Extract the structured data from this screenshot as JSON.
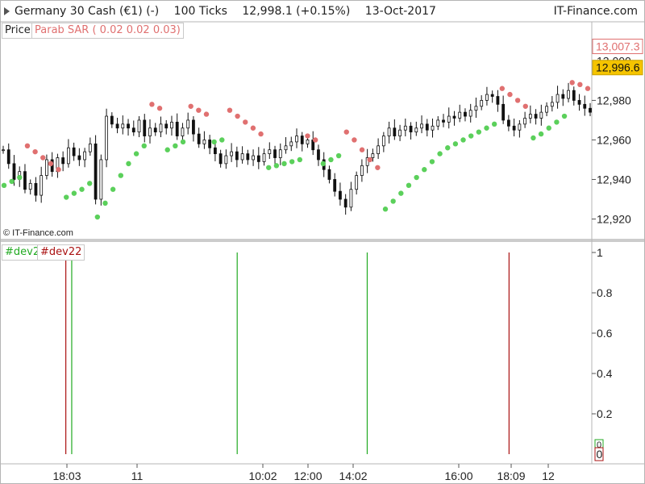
{
  "title_bar": {
    "instrument": "Germany 30 Cash (€1) (-)",
    "timeframe": "100 Ticks",
    "last_price": "12,998.1 (+0.15%)",
    "date": "13-Oct-2017",
    "brand": "IT-Finance.com"
  },
  "price_panel": {
    "legend_price": "Price",
    "legend_indicator": "Parab SAR ( 0.02 0.02 0.03)",
    "watermark": "© IT-Finance.com",
    "sar_label": "13,007.3",
    "price_label": "12,996.6",
    "hidden_tick": "13,000"
  },
  "indicator_panel": {
    "legend_dev2": "#dev2",
    "legend_dev22": "#dev22"
  },
  "colors": {
    "sar_above": "#e07070",
    "sar_below": "#5bd05b",
    "dev2": "#22aa22",
    "dev22": "#aa1111",
    "price_label_bg": "#f5c400"
  },
  "chart_data": [
    {
      "type": "line",
      "title": "Germany 30 Cash (€1) (-)",
      "ylim": [
        12910,
        13012
      ],
      "y_ticks": [
        "12,920",
        "12,940",
        "12,960",
        "12,980"
      ],
      "x_tick_labels": [
        "18:03",
        "11",
        "10:02",
        "12:00",
        "14:02",
        "16:00",
        "18:09",
        "12"
      ],
      "series": [
        {
          "name": "Price",
          "type": "candlestick",
          "values": [
            12955,
            12948,
            12940,
            12944,
            12935,
            12938,
            12932,
            12942,
            12950,
            12944,
            12951,
            12948,
            12956,
            12952,
            12950,
            12954,
            12958,
            12930,
            12950,
            12972,
            12968,
            12966,
            12968,
            12966,
            12964,
            12970,
            12962,
            12966,
            12964,
            12968,
            12966,
            12969,
            12962,
            12966,
            12970,
            12963,
            12958,
            12960,
            12956,
            12953,
            12948,
            12952,
            12954,
            12950,
            12953,
            12950,
            12952,
            12949,
            12953,
            12955,
            12951,
            12955,
            12957,
            12959,
            12962,
            12958,
            12960,
            12955,
            12950,
            12945,
            12940,
            12934,
            12930,
            12926,
            12935,
            12942,
            12947,
            12951,
            12953,
            12957,
            12962,
            12966,
            12962,
            12965,
            12967,
            12964,
            12966,
            12968,
            12965,
            12967,
            12970,
            12969,
            12972,
            12971,
            12974,
            12972,
            12975,
            12977,
            12980,
            12983,
            12982,
            12978,
            12970,
            12967,
            12965,
            12968,
            12971,
            12973,
            12971,
            12974,
            12977,
            12979,
            12983,
            12981,
            12985,
            12980,
            12978,
            12976,
            12974
          ]
        },
        {
          "name": "Parab SAR ( 0.02 0.02 0.03)",
          "type": "scatter",
          "points": [
            {
              "x": 0,
              "y": 12937,
              "side": "below"
            },
            {
              "x": 1,
              "y": 12939,
              "side": "below"
            },
            {
              "x": 2,
              "y": 12941,
              "side": "below"
            },
            {
              "x": 3,
              "y": 12957,
              "side": "above"
            },
            {
              "x": 4,
              "y": 12954,
              "side": "above"
            },
            {
              "x": 5,
              "y": 12951,
              "side": "above"
            },
            {
              "x": 6,
              "y": 12948,
              "side": "above"
            },
            {
              "x": 7,
              "y": 12945,
              "side": "above"
            },
            {
              "x": 8,
              "y": 12931,
              "side": "below"
            },
            {
              "x": 9,
              "y": 12933,
              "side": "below"
            },
            {
              "x": 10,
              "y": 12935,
              "side": "below"
            },
            {
              "x": 11,
              "y": 12938,
              "side": "below"
            },
            {
              "x": 12,
              "y": 12921,
              "side": "below"
            },
            {
              "x": 13,
              "y": 12928,
              "side": "below"
            },
            {
              "x": 14,
              "y": 12935,
              "side": "below"
            },
            {
              "x": 15,
              "y": 12942,
              "side": "below"
            },
            {
              "x": 16,
              "y": 12948,
              "side": "below"
            },
            {
              "x": 17,
              "y": 12953,
              "side": "below"
            },
            {
              "x": 18,
              "y": 12957,
              "side": "below"
            },
            {
              "x": 19,
              "y": 12978,
              "side": "above"
            },
            {
              "x": 20,
              "y": 12976,
              "side": "above"
            },
            {
              "x": 21,
              "y": 12955,
              "side": "below"
            },
            {
              "x": 22,
              "y": 12957,
              "side": "below"
            },
            {
              "x": 23,
              "y": 12959,
              "side": "below"
            },
            {
              "x": 24,
              "y": 12977,
              "side": "above"
            },
            {
              "x": 25,
              "y": 12975,
              "side": "above"
            },
            {
              "x": 26,
              "y": 12973,
              "side": "above"
            },
            {
              "x": 27,
              "y": 12959,
              "side": "below"
            },
            {
              "x": 28,
              "y": 12960,
              "side": "below"
            },
            {
              "x": 29,
              "y": 12975,
              "side": "above"
            },
            {
              "x": 30,
              "y": 12972,
              "side": "above"
            },
            {
              "x": 31,
              "y": 12969,
              "side": "above"
            },
            {
              "x": 32,
              "y": 12966,
              "side": "above"
            },
            {
              "x": 33,
              "y": 12963,
              "side": "above"
            },
            {
              "x": 34,
              "y": 12946,
              "side": "below"
            },
            {
              "x": 35,
              "y": 12947,
              "side": "below"
            },
            {
              "x": 36,
              "y": 12948,
              "side": "below"
            },
            {
              "x": 37,
              "y": 12949,
              "side": "below"
            },
            {
              "x": 38,
              "y": 12950,
              "side": "below"
            },
            {
              "x": 39,
              "y": 12962,
              "side": "above"
            },
            {
              "x": 40,
              "y": 12960,
              "side": "above"
            },
            {
              "x": 41,
              "y": 12948,
              "side": "below"
            },
            {
              "x": 42,
              "y": 12950,
              "side": "below"
            },
            {
              "x": 43,
              "y": 12952,
              "side": "below"
            },
            {
              "x": 44,
              "y": 12964,
              "side": "above"
            },
            {
              "x": 45,
              "y": 12960,
              "side": "above"
            },
            {
              "x": 46,
              "y": 12955,
              "side": "above"
            },
            {
              "x": 47,
              "y": 12950,
              "side": "above"
            },
            {
              "x": 48,
              "y": 12946,
              "side": "above"
            },
            {
              "x": 49,
              "y": 12925,
              "side": "below"
            },
            {
              "x": 50,
              "y": 12929,
              "side": "below"
            },
            {
              "x": 51,
              "y": 12933,
              "side": "below"
            },
            {
              "x": 52,
              "y": 12937,
              "side": "below"
            },
            {
              "x": 53,
              "y": 12941,
              "side": "below"
            },
            {
              "x": 54,
              "y": 12945,
              "side": "below"
            },
            {
              "x": 55,
              "y": 12949,
              "side": "below"
            },
            {
              "x": 56,
              "y": 12953,
              "side": "below"
            },
            {
              "x": 57,
              "y": 12956,
              "side": "below"
            },
            {
              "x": 58,
              "y": 12958,
              "side": "below"
            },
            {
              "x": 59,
              "y": 12960,
              "side": "below"
            },
            {
              "x": 60,
              "y": 12962,
              "side": "below"
            },
            {
              "x": 61,
              "y": 12964,
              "side": "below"
            },
            {
              "x": 62,
              "y": 12966,
              "side": "below"
            },
            {
              "x": 63,
              "y": 12968,
              "side": "below"
            },
            {
              "x": 64,
              "y": 12986,
              "side": "above"
            },
            {
              "x": 65,
              "y": 12983,
              "side": "above"
            },
            {
              "x": 66,
              "y": 12980,
              "side": "above"
            },
            {
              "x": 67,
              "y": 12977,
              "side": "above"
            },
            {
              "x": 68,
              "y": 12961,
              "side": "below"
            },
            {
              "x": 69,
              "y": 12963,
              "side": "below"
            },
            {
              "x": 70,
              "y": 12966,
              "side": "below"
            },
            {
              "x": 71,
              "y": 12969,
              "side": "below"
            },
            {
              "x": 72,
              "y": 12972,
              "side": "below"
            },
            {
              "x": 73,
              "y": 12989,
              "side": "above"
            },
            {
              "x": 74,
              "y": 12988,
              "side": "above"
            },
            {
              "x": 75,
              "y": 12986,
              "side": "above"
            }
          ]
        }
      ]
    },
    {
      "type": "bar",
      "ylim": [
        0,
        1
      ],
      "y_ticks": [
        "1",
        "0.8",
        "0.6",
        "0.4",
        "0.2",
        "0"
      ],
      "series": [
        {
          "name": "#dev2",
          "x": [
            12,
            40,
            62
          ],
          "values": [
            1,
            1,
            1
          ]
        },
        {
          "name": "#dev22",
          "x": [
            11,
            86
          ],
          "values": [
            1,
            1
          ]
        }
      ],
      "x_domain": [
        0,
        100
      ],
      "last_values": {
        "dev2": "0",
        "dev22": "0"
      }
    }
  ]
}
